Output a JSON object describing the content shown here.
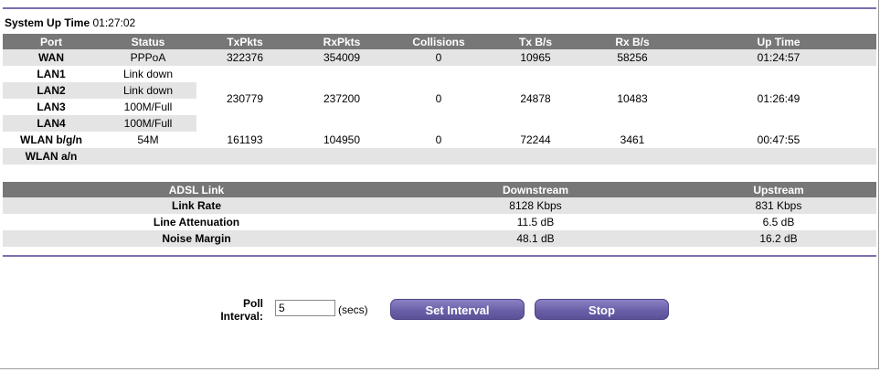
{
  "uptime": {
    "label": "System Up Time",
    "value": "01:27:02"
  },
  "stats": {
    "headers": [
      "Port",
      "Status",
      "TxPkts",
      "RxPkts",
      "Collisions",
      "Tx B/s",
      "Rx B/s",
      "Up Time"
    ],
    "wan": {
      "port": "WAN",
      "status": "PPPoA",
      "tx": "322376",
      "rx": "354009",
      "col": "0",
      "txbs": "10965",
      "rxbs": "58256",
      "up": "01:24:57"
    },
    "lan": {
      "ports": [
        {
          "port": "LAN1",
          "status": "Link down"
        },
        {
          "port": "LAN2",
          "status": "Link down"
        },
        {
          "port": "LAN3",
          "status": "100M/Full"
        },
        {
          "port": "LAN4",
          "status": "100M/Full"
        }
      ],
      "tx": "230779",
      "rx": "237200",
      "col": "0",
      "txbs": "24878",
      "rxbs": "10483",
      "up": "01:26:49"
    },
    "wlan_bgn": {
      "port": "WLAN b/g/n",
      "status": "54M",
      "tx": "161193",
      "rx": "104950",
      "col": "0",
      "txbs": "72244",
      "rxbs": "3461",
      "up": "00:47:55"
    },
    "wlan_an": {
      "port": "WLAN a/n"
    }
  },
  "adsl": {
    "headers": [
      "ADSL Link",
      "Downstream",
      "Upstream"
    ],
    "rows": [
      {
        "label": "Link Rate",
        "down": "8128 Kbps",
        "up": "831 Kbps"
      },
      {
        "label": "Line Attenuation",
        "down": "11.5 dB",
        "up": "6.5 dB"
      },
      {
        "label": "Noise Margin",
        "down": "48.1 dB",
        "up": "16.2 dB"
      }
    ]
  },
  "poll": {
    "label_line1": "Poll",
    "label_line2": "Interval:",
    "value": "5",
    "unit": "(secs)"
  },
  "buttons": {
    "set_interval": "Set Interval",
    "stop": "Stop"
  },
  "colors": {
    "header_bg": "#777777",
    "row_shade": "#e4e4e4",
    "accent": "#6a60a8"
  }
}
